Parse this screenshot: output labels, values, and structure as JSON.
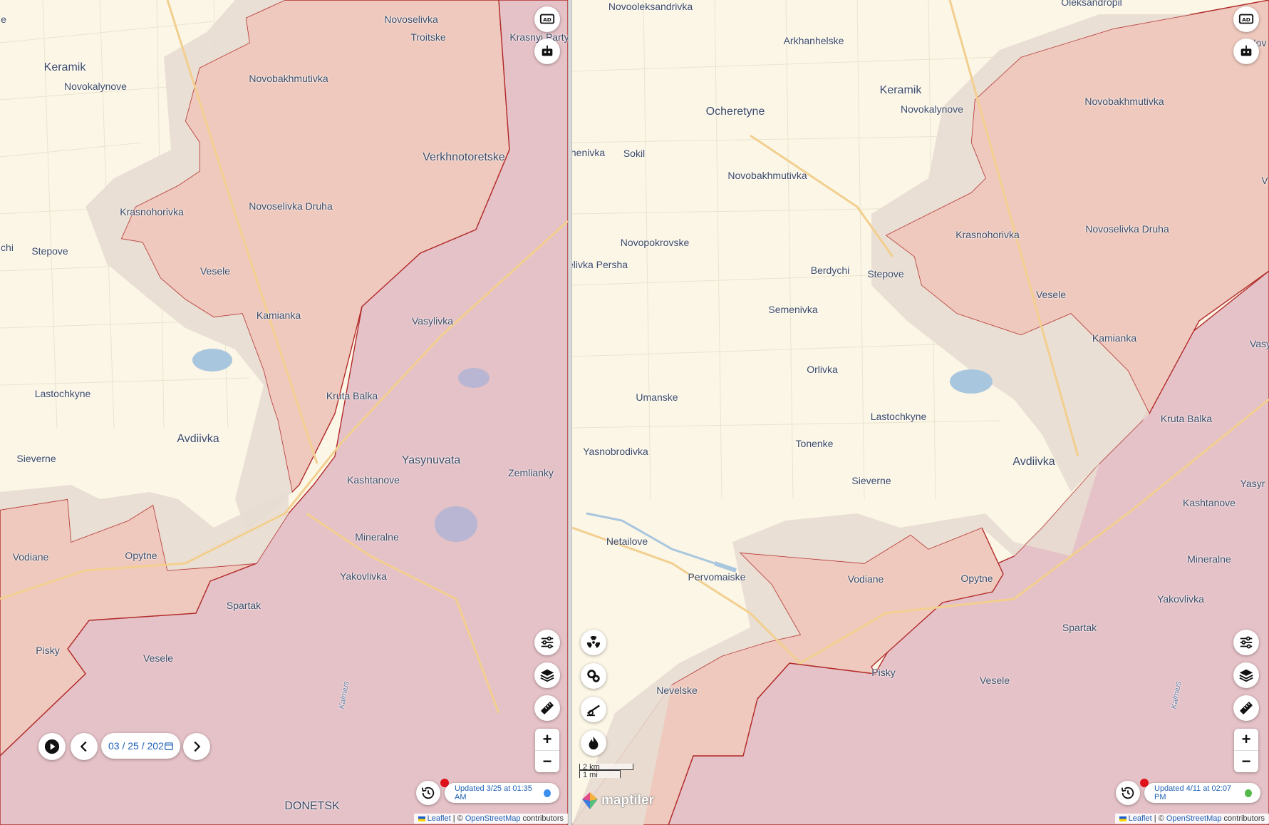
{
  "colors": {
    "land": "#fcf6e6",
    "occupied": "#efc9bd",
    "occupied_border": "#b22b2b",
    "gray_zone": "#e8ddd2",
    "pre2022": "#e5c2c7",
    "water": "#a9c6df",
    "road": "#f2cf8f",
    "accent": "#1e5fb4",
    "status_dot_left": "#3b8ff0",
    "status_dot_right": "#55b94a"
  },
  "left_map": {
    "places": [
      {
        "name": "Keramik"
      },
      {
        "name": "Novokalynove"
      },
      {
        "name": "Novoselivka"
      },
      {
        "name": "Troitske"
      },
      {
        "name": "Krasnyi Party"
      },
      {
        "name": "Novobakhmutivka"
      },
      {
        "name": "Verkhnotoretske"
      },
      {
        "name": "Krasnohorivka"
      },
      {
        "name": "Novoselivka Druha"
      },
      {
        "name": "Stepove"
      },
      {
        "name": "chi"
      },
      {
        "name": "Vesele"
      },
      {
        "name": "Kamianka"
      },
      {
        "name": "Vasylivka"
      },
      {
        "name": "Lastochkyne"
      },
      {
        "name": "Kruta Balka"
      },
      {
        "name": "Avdiivka"
      },
      {
        "name": "Yasynuvata"
      },
      {
        "name": "Sieverne"
      },
      {
        "name": "Kashtanove"
      },
      {
        "name": "Zemlianky"
      },
      {
        "name": "Mineralne"
      },
      {
        "name": "Vodiane"
      },
      {
        "name": "Opytne"
      },
      {
        "name": "Yakovlivka"
      },
      {
        "name": "Spartak"
      },
      {
        "name": "Pisky"
      },
      {
        "name": "Vesele"
      },
      {
        "name": "Kalmius"
      },
      {
        "name": "DONETSK"
      },
      {
        "name": "e"
      }
    ],
    "date_value": "03 / 25 / 202",
    "status_text": "Updated 3/25 at 01:35 AM",
    "icons": [
      "ad-icon",
      "robot-icon",
      "filter-icon",
      "layers-icon",
      "ruler-icon",
      "history-icon",
      "play-icon",
      "chevron-left-icon",
      "calendar-icon",
      "chevron-right-icon"
    ]
  },
  "right_map": {
    "places": [
      {
        "name": "Novooleksandrivka"
      },
      {
        "name": "Oleksandropil"
      },
      {
        "name": "Arkhanhelske"
      },
      {
        "name": "Nov"
      },
      {
        "name": "Keramik"
      },
      {
        "name": "Novokalynove"
      },
      {
        "name": "Novobakhmutivka"
      },
      {
        "name": "Ocheretyne"
      },
      {
        "name": "henivka"
      },
      {
        "name": "Sokil"
      },
      {
        "name": "Novobakhmutivka"
      },
      {
        "name": "V"
      },
      {
        "name": "Krasnohorivka"
      },
      {
        "name": "Novoselivka Druha"
      },
      {
        "name": "Novopokrovske"
      },
      {
        "name": "elivka Persha"
      },
      {
        "name": "Berdychi"
      },
      {
        "name": "Stepove"
      },
      {
        "name": "Vesele"
      },
      {
        "name": "Semenivka"
      },
      {
        "name": "Kamianka"
      },
      {
        "name": "Vasy"
      },
      {
        "name": "Orlivka"
      },
      {
        "name": "Umanske"
      },
      {
        "name": "Lastochkyne"
      },
      {
        "name": "Kruta Balka"
      },
      {
        "name": "Tonenke"
      },
      {
        "name": "Yasnobrodivka"
      },
      {
        "name": "Avdiivka"
      },
      {
        "name": "Yasyr"
      },
      {
        "name": "Sieverne"
      },
      {
        "name": "Kashtanove"
      },
      {
        "name": "Netailove"
      },
      {
        "name": "Mineralne"
      },
      {
        "name": "Pervomaiske"
      },
      {
        "name": "Vodiane"
      },
      {
        "name": "Opytne"
      },
      {
        "name": "Yakovlivka"
      },
      {
        "name": "Spartak"
      },
      {
        "name": "Pisky"
      },
      {
        "name": "Vesele"
      },
      {
        "name": "Nevelske"
      },
      {
        "name": "Kalmius"
      }
    ],
    "scale_km": "2 km",
    "scale_mi": "1 mi",
    "logo_text": "maptiler",
    "status_text": "Updated 4/11 at 02:07 PM",
    "icons": [
      "radiation-icon",
      "gears-icon",
      "artillery-icon",
      "fire-icon",
      "ad-icon",
      "robot-icon",
      "filter-icon",
      "layers-icon",
      "ruler-icon",
      "history-icon"
    ]
  },
  "zoom": {
    "in": "+",
    "out": "−"
  },
  "attribution": {
    "leaflet": "Leaflet",
    "sep": " | © ",
    "osm": "OpenStreetMap",
    "suffix": " contributors"
  }
}
